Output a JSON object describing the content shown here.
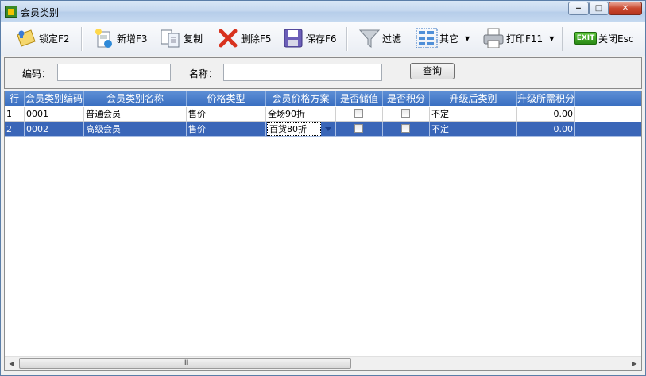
{
  "window": {
    "title": "会员类别",
    "controls": {
      "minimize": "‒",
      "maximize": "□",
      "close": "✕"
    }
  },
  "toolbar": {
    "lock": "锁定F2",
    "new": "新增F3",
    "copy": "复制",
    "delete": "删除F5",
    "save": "保存F6",
    "filter": "过滤",
    "other": "其它",
    "print": "打印F11",
    "close": "关闭Esc",
    "close_icon_text": "EXIT"
  },
  "search": {
    "code_label": "编码：",
    "code_value": "",
    "name_label": "名称：",
    "name_value": "",
    "query_button": "查询"
  },
  "grid": {
    "columns": [
      "行",
      "会员类别编码",
      "会员类别名称",
      "价格类型",
      "会员价格方案",
      "是否储值",
      "是否积分",
      "升级后类别",
      "升级所需积分"
    ],
    "rows": [
      {
        "row": "1",
        "code": "0001",
        "name": "普通会员",
        "price_type": "售价",
        "price_plan": "全场90折",
        "stored_value": false,
        "points": false,
        "upgrade_category": "不定",
        "upgrade_points": "0.00"
      },
      {
        "row": "2",
        "code": "0002",
        "name": "高级会员",
        "price_type": "售价",
        "price_plan": "百货80折",
        "stored_value": false,
        "points": false,
        "upgrade_category": "不定",
        "upgrade_points": "0.00"
      }
    ],
    "selected_row": 2,
    "scrollbar_grip": "III"
  },
  "colors": {
    "header_bg": "#4a7cc9",
    "selected_row_bg": "#3a66b8",
    "title_bar": "#c3d6ee"
  }
}
